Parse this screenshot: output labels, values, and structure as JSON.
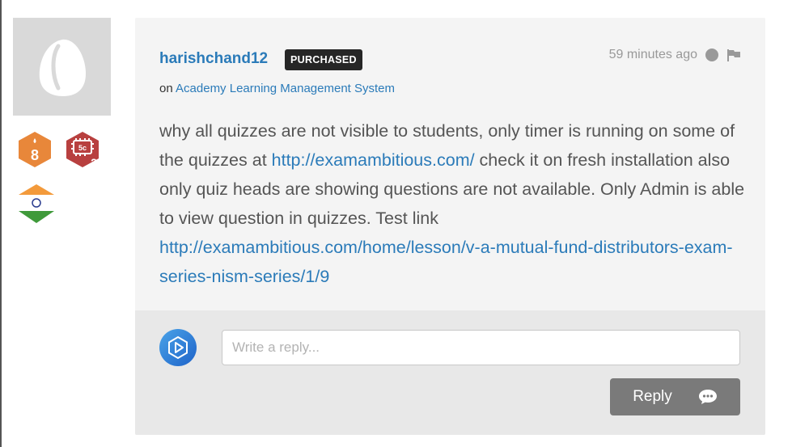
{
  "user": {
    "name": "harishchand12",
    "purchased_badge": "PURCHASED",
    "badges": [
      {
        "icon": "author-level-badge-icon",
        "text": "8",
        "color": "#e8873a"
      },
      {
        "icon": "microchip-badge-icon",
        "text": "5c",
        "subtext": "2",
        "color": "#b8403f"
      }
    ],
    "country_flag": "india-flag-icon"
  },
  "comment": {
    "timestamp": "59 minutes ago",
    "on_prefix": "on",
    "item_link": "Academy Learning Management System",
    "text_part1": "why all quizzes are not visible to students, only timer is running on some of the quizzes at ",
    "link1": "http://examambitious.com/",
    "text_part2": " check it on fresh installation also only quiz heads are showing questions are not available. Only Admin is able to view question in quizzes. Test link ",
    "link2": "http://examambitious.com/home/lesson/v-a-mutual-fund-distributors-exam-series-nism-series/1/9"
  },
  "reply": {
    "placeholder": "Write a reply...",
    "button_label": "Reply"
  },
  "colors": {
    "link": "#2b7bb9",
    "card_bg": "#f4f4f4",
    "reply_area_bg": "#e8e8e8",
    "button_bg": "#7a7a7a"
  }
}
